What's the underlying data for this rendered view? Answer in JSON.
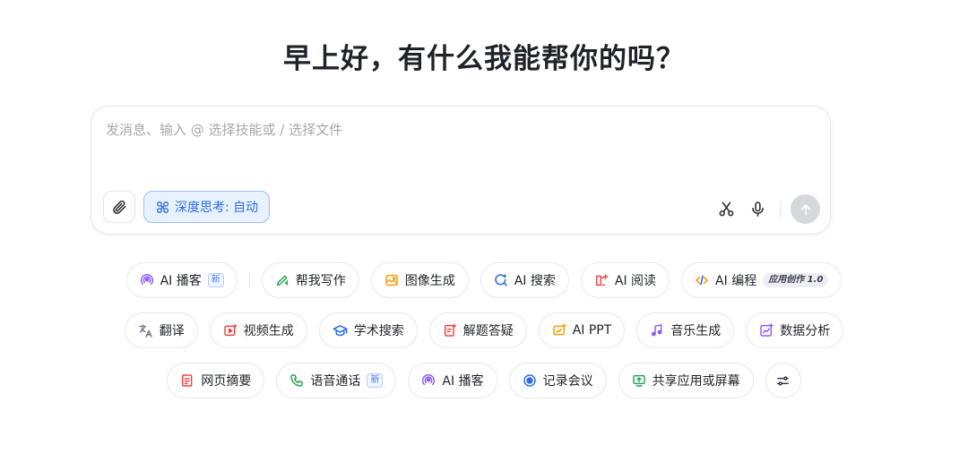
{
  "greeting": "早上好，有什么我能帮你的吗？",
  "composer": {
    "placeholder": "发消息、输入 @ 选择技能或 / 选择文件",
    "deep_think_label": "深度思考: 自动"
  },
  "chips_row1": [
    {
      "label": "AI 播客",
      "icon": "podcast-icon",
      "badge": "新"
    },
    {
      "label": "帮我写作",
      "icon": "pen-icon"
    },
    {
      "label": "图像生成",
      "icon": "image-icon"
    },
    {
      "label": "AI 搜索",
      "icon": "search-icon"
    },
    {
      "label": "AI 阅读",
      "icon": "book-icon"
    },
    {
      "label": "AI 编程",
      "icon": "code-icon",
      "badge": "应用创作 1.0"
    }
  ],
  "chips_row2": [
    {
      "label": "翻译",
      "icon": "translate-icon"
    },
    {
      "label": "视频生成",
      "icon": "video-icon"
    },
    {
      "label": "学术搜索",
      "icon": "academic-icon"
    },
    {
      "label": "解题答疑",
      "icon": "solve-icon"
    },
    {
      "label": "AI PPT",
      "icon": "ppt-icon"
    },
    {
      "label": "音乐生成",
      "icon": "music-icon"
    },
    {
      "label": "数据分析",
      "icon": "chart-icon"
    }
  ],
  "chips_row3": [
    {
      "label": "网页摘要",
      "icon": "webpage-icon"
    },
    {
      "label": "语音通话",
      "icon": "phone-icon",
      "badge": "新"
    },
    {
      "label": "AI 播客",
      "icon": "podcast-icon"
    },
    {
      "label": "记录会议",
      "icon": "record-icon"
    },
    {
      "label": "共享应用或屏幕",
      "icon": "screen-share-icon"
    }
  ],
  "colors": {
    "accent": "#2f6ee8",
    "podcast": "#8b5cf6",
    "write": "#22a355",
    "image": "#f59e0b",
    "search": "#2f6ee8",
    "read": "#ef4444",
    "code": "#f59e0b",
    "translate": "#6b7280",
    "video": "#ef4444",
    "academic": "#2f6ee8",
    "solve": "#ef4444",
    "ppt": "#f59e0b",
    "music": "#8b5cf6",
    "chart": "#8b5cf6",
    "webpage": "#ef4444",
    "phone": "#22a355",
    "record": "#2f6ee8",
    "screen": "#22a355"
  }
}
